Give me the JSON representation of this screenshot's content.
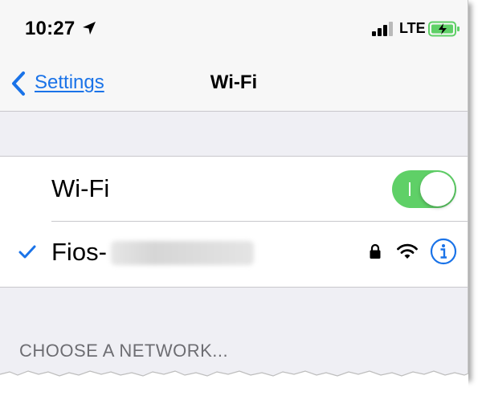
{
  "status_bar": {
    "time": "10:27",
    "network_type": "LTE",
    "battery_color": "#5fd067"
  },
  "nav": {
    "back_label": "Settings",
    "title": "Wi-Fi"
  },
  "wifi_row": {
    "label": "Wi-Fi",
    "toggle_on": true,
    "toggle_color": "#5fd067"
  },
  "connected_network": {
    "name": "Fios-",
    "name_obscured": true,
    "secured_icon": "lock-icon",
    "signal_icon": "wifi-signal-icon",
    "info_icon": "info-icon",
    "accent_color": "#1a73e8"
  },
  "section": {
    "header": "CHOOSE A NETWORK..."
  }
}
